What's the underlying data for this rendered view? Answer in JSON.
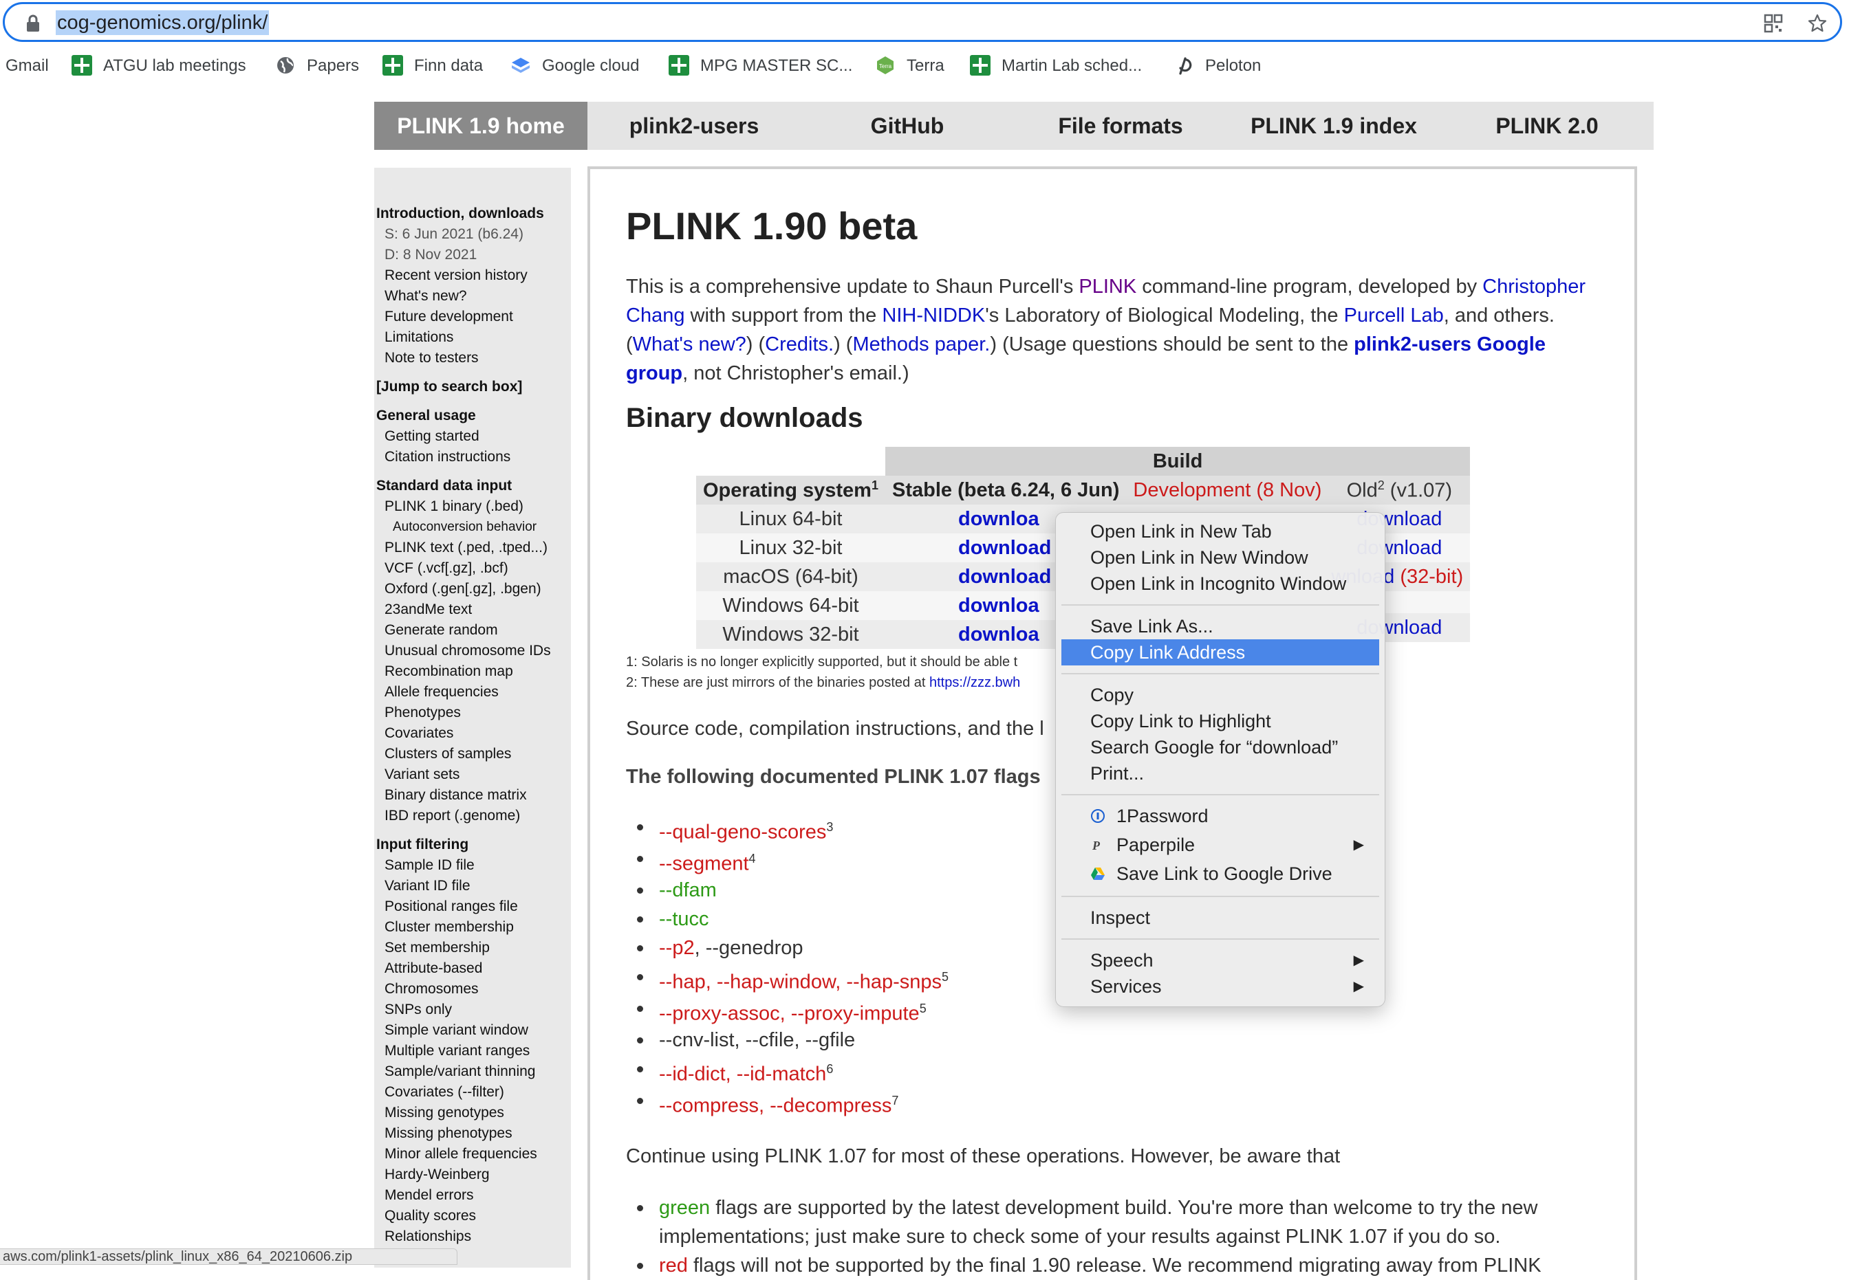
{
  "browser": {
    "url": "cog-genomics.org/plink/",
    "bookmarks": [
      {
        "label": "Gmail",
        "icon": "none"
      },
      {
        "label": "ATGU lab meetings",
        "icon": "sheets-icon"
      },
      {
        "label": "Papers",
        "icon": "globe-icon"
      },
      {
        "label": "Finn data",
        "icon": "sheets-icon"
      },
      {
        "label": "Google cloud",
        "icon": "cloud-icon"
      },
      {
        "label": "MPG MASTER SC...",
        "icon": "sheets-icon"
      },
      {
        "label": "Terra",
        "icon": "terra-icon"
      },
      {
        "label": "Martin Lab sched...",
        "icon": "sheets-icon"
      },
      {
        "label": "Peloton",
        "icon": "peloton-icon"
      }
    ],
    "status_url": "aws.com/plink1-assets/plink_linux_x86_64_20210606.zip"
  },
  "nav": {
    "items": [
      "PLINK 1.9 home",
      "plink2-users",
      "GitHub",
      "File formats",
      "PLINK 1.9 index",
      "PLINK 2.0"
    ]
  },
  "sidebar": {
    "intro_head": "Introduction, downloads",
    "stable": "S: 6 Jun 2021 (b6.24)",
    "dev": "D: 8 Nov 2021",
    "intro_items": [
      "Recent version history",
      "What's new?",
      "Future development",
      "Limitations",
      "Note to testers"
    ],
    "jump": "[Jump to search box]",
    "general_head": "General usage",
    "general_items": [
      "Getting started",
      "Citation instructions"
    ],
    "std_head": "Standard data input",
    "std_item0": "PLINK 1 binary (.bed)",
    "std_sub": "Autoconversion behavior",
    "std_items": [
      "PLINK text (.ped, .tped...)",
      "VCF (.vcf[.gz], .bcf)",
      "Oxford (.gen[.gz], .bgen)",
      "23andMe text",
      "Generate random",
      "Unusual chromosome IDs",
      "Recombination map",
      "Allele frequencies",
      "Phenotypes",
      "Covariates",
      "Clusters of samples",
      "Variant sets",
      "Binary distance matrix",
      "IBD report (.genome)"
    ],
    "filter_head": "Input filtering",
    "filter_items": [
      "Sample ID file",
      "Variant ID file",
      "Positional ranges file",
      "Cluster membership",
      "Set membership",
      "Attribute-based",
      "Chromosomes",
      "SNPs only",
      "Simple variant window",
      "Multiple variant ranges",
      "Sample/variant thinning",
      "Covariates (--filter)",
      "Missing genotypes",
      "Missing phenotypes",
      "Minor allele frequencies",
      "Hardy-Weinberg",
      "Mendel errors",
      "Quality scores",
      "Relationships"
    ]
  },
  "main": {
    "title": "PLINK 1.90 beta",
    "intro": {
      "t1": "This is a comprehensive update to Shaun Purcell's ",
      "l_plink": "PLINK",
      "t2": " command-line program, developed by ",
      "l_chris": "Christopher Chang",
      "t3": " with support from the ",
      "l_nih": "NIH-NIDDK",
      "t4": "'s Laboratory of Biological Modeling, the ",
      "l_purcell": "Purcell Lab",
      "t5": ", and others. (",
      "l_new": "What's new?",
      "t6": ") (",
      "l_credits": "Credits.",
      "t7": ") (",
      "l_methods": "Methods paper.",
      "t8": ") (Usage questions should be sent to the ",
      "l_group": "plink2-users Google group",
      "t9": ", not Christopher's email.)"
    },
    "binary_heading": "Binary downloads",
    "table": {
      "build": "Build",
      "os_header": "Operating system",
      "os_sup": "1",
      "stable_header": "Stable (beta 6.24, 6 Jun)",
      "dev_header": "Development (8 Nov)",
      "old_header": "Old",
      "old_sup": "2",
      "old_version": "(v1.07)",
      "rows": [
        {
          "os": "Linux 64-bit",
          "stable": "downloa",
          "old": "download",
          "old_extra": ""
        },
        {
          "os": "Linux 32-bit",
          "stable": "download",
          "old": "download",
          "old_extra": ""
        },
        {
          "os": "macOS (64-bit)",
          "stable": "download",
          "old": "wnload",
          "old_extra": "(32-bit)"
        },
        {
          "os": "Windows 64-bit",
          "stable": "downloa",
          "old": "",
          "old_extra": ""
        },
        {
          "os": "Windows 32-bit",
          "stable": "downloa",
          "old": "download",
          "old_extra": ""
        }
      ]
    },
    "footnote1": "1: Solaris is no longer explicitly supported, but it should be able t",
    "footnote2_text": "2: These are just mirrors of the binaries posted at ",
    "footnote2_link": "https://zzz.bwh",
    "source_line": "Source code, compilation instructions, and the l",
    "flags_heading": "The following documented PLINK 1.07 flags",
    "flags": [
      {
        "text": "--qual-geno-scores",
        "sup": "3",
        "color": "#cc1a1a",
        "tail": ""
      },
      {
        "text": "--segment",
        "sup": "4",
        "color": "#cc1a1a",
        "tail": ""
      },
      {
        "text": "--dfam",
        "sup": "",
        "color": "#2d9a16",
        "tail": ""
      },
      {
        "text": "--tucc",
        "sup": "",
        "color": "#2d9a16",
        "tail": ""
      },
      {
        "text": "--p2",
        "sup": "",
        "color": "#cc1a1a",
        "tail": ", --genedrop"
      },
      {
        "text": "--hap, --hap-window, --hap-snps",
        "sup": "5",
        "color": "#cc1a1a",
        "tail": ""
      },
      {
        "text": "--proxy-assoc, --proxy-impute",
        "sup": "5",
        "color": "#cc1a1a",
        "tail": ""
      },
      {
        "text": "--cnv-list, --cfile, --gfile",
        "sup": "",
        "color": "#333333",
        "tail": ""
      },
      {
        "text": "--id-dict, --id-match",
        "sup": "6",
        "color": "#cc1a1a",
        "tail": ""
      },
      {
        "text": "--compress, --decompress",
        "sup": "7",
        "color": "#cc1a1a",
        "tail": ""
      }
    ],
    "continue_line": "Continue using PLINK 1.07 for most of these operations. However, be aware that",
    "green_word": "green",
    "green_text": " flags are supported by the latest development build. You're more than welcome to try the new implementations; just make sure to check some of your results against PLINK 1.07 if you do so.",
    "red_word": "red",
    "red_text": " flags will not be supported by the final 1.90 release. We recommend migrating away from PLINK"
  },
  "context_menu": {
    "open_new_tab": "Open Link in New Tab",
    "open_new_window": "Open Link in New Window",
    "open_incognito": "Open Link in Incognito Window",
    "save_link_as": "Save Link As...",
    "copy_link_address": "Copy Link Address",
    "copy": "Copy",
    "copy_link_highlight": "Copy Link to Highlight",
    "search_google": "Search Google for “download”",
    "print": "Print...",
    "onepassword": "1Password",
    "paperpile": "Paperpile",
    "save_drive": "Save Link to Google Drive",
    "inspect": "Inspect",
    "speech": "Speech",
    "services": "Services"
  }
}
